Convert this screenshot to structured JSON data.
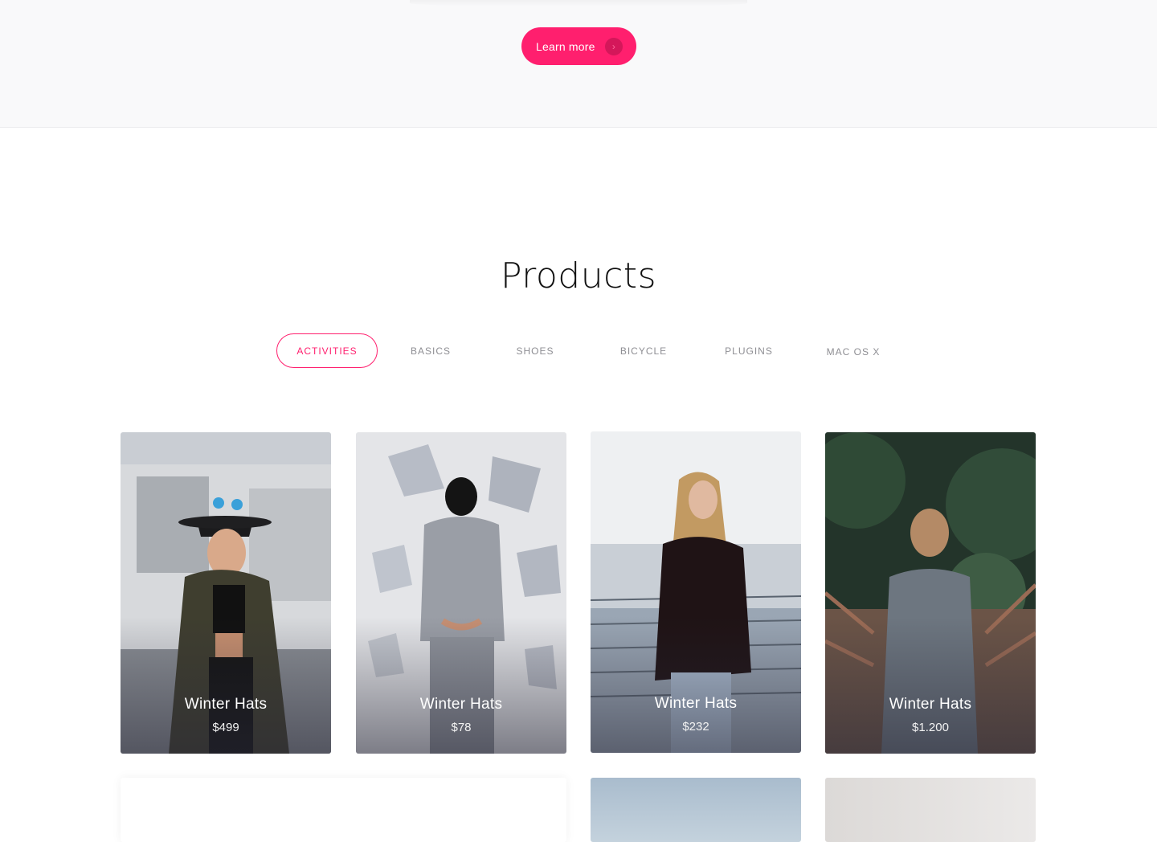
{
  "hero": {
    "learn_more_label": "Learn more",
    "arrow_glyph": "›"
  },
  "products": {
    "title": "Products",
    "tabs": [
      {
        "label": "ACTIVITIES",
        "active": true
      },
      {
        "label": "BASICS",
        "active": false
      },
      {
        "label": "SHOES",
        "active": false
      },
      {
        "label": "BICYCLE",
        "active": false
      },
      {
        "label": "PLUGINS",
        "active": false
      },
      {
        "label": "MAC OS X",
        "active": false
      }
    ],
    "cards": [
      {
        "name": "Winter Hats",
        "price": "$499"
      },
      {
        "name": "Winter Hats",
        "price": "$78"
      },
      {
        "name": "Winter Hats",
        "price": "$232"
      },
      {
        "name": "Winter Hats",
        "price": "$1.200"
      }
    ]
  },
  "colors": {
    "accent": "#ff1f6e",
    "band_background": "#f9f9fa",
    "tab_text": "#8e8e93"
  }
}
